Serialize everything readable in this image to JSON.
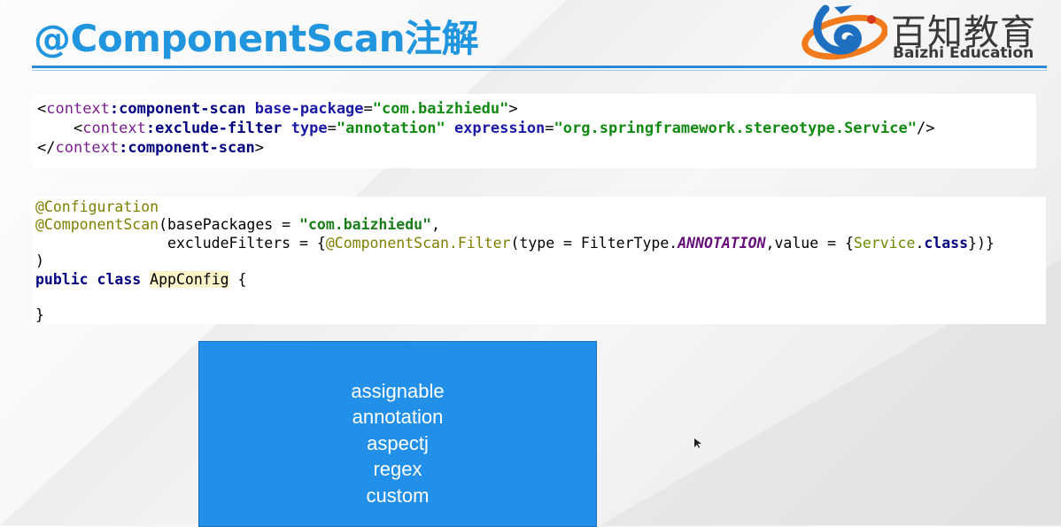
{
  "slide": {
    "title": "@ComponentScan注解"
  },
  "logo": {
    "name_cn": "百知教育",
    "name_en": "Baizhi Education",
    "colors": {
      "blue": "#1f6fc0",
      "orange": "#f07a1c",
      "red": "#d83a1e"
    }
  },
  "xml_code": {
    "line1": {
      "open": "<",
      "ns": "context",
      "colon": ":",
      "tag": "component-scan",
      "attr": "base-package",
      "eq": "=",
      "val": "\"com.baizhiedu\"",
      "close": ">"
    },
    "line2": {
      "open": "<",
      "ns": "context",
      "colon": ":",
      "tag": "exclude-filter",
      "attr1": "type",
      "eq1": "=",
      "val1": "\"annotation\"",
      "attr2": "expression",
      "eq2": "=",
      "val2": "\"org.springframework.stereotype.Service\"",
      "close": "/>"
    },
    "line3": {
      "open": "</",
      "ns": "context",
      "colon": ":",
      "tag": "component-scan",
      "close": ">"
    }
  },
  "java_code": {
    "line1": {
      "annotation": "@Configuration"
    },
    "line2": {
      "annotation": "@ComponentScan",
      "rest1": "(basePackages = ",
      "str": "\"com.baizhiedu\"",
      "rest2": ","
    },
    "line3": {
      "indent": "               ",
      "text1": "excludeFilters = {",
      "annotation": "@ComponentScan.Filter",
      "text2": "(type = FilterType.",
      "enum": "ANNOTATION",
      "text3": ",value = {",
      "svc": "Service",
      "text4": ".",
      "kw": "class",
      "text5": "})}"
    },
    "line4": {
      "text": ")"
    },
    "line5": {
      "kw1": "public",
      "kw2": "class",
      "name": "AppConfig",
      "brace": " {"
    },
    "line6": {
      "text": "}"
    }
  },
  "filter_types": [
    "assignable",
    "annotation",
    "aspectj",
    "regex",
    "custom"
  ],
  "colors": {
    "title": "#2196df",
    "box": "#2290e9"
  }
}
